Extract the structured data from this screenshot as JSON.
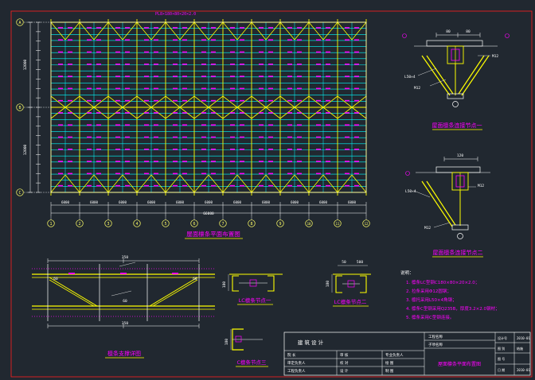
{
  "drawing": {
    "colors": {
      "background": "#212830",
      "purlin": "#00ffff",
      "bracing": "#ffff00",
      "dimension": "#ffffff",
      "annotation": "#ff00ff",
      "frame": "#ff2020",
      "grid_circle": "#ffff66",
      "highlight_text": "#ffff00"
    },
    "plan": {
      "top_label": "PL8×180×80×20×2.0",
      "title": "屋面檩条平面布置图",
      "column_labels": [
        "1",
        "2",
        "3",
        "4",
        "5",
        "6",
        "7",
        "8",
        "9",
        "10",
        "11",
        "12"
      ],
      "row_labels": [
        "A",
        "B",
        "C"
      ],
      "bay_dims": [
        "6000",
        "6000",
        "6000",
        "6000",
        "6000",
        "6000",
        "6000",
        "6000",
        "6000",
        "6000",
        "6000"
      ],
      "total_dim": "66000",
      "left_dims": [
        "12000",
        "12000"
      ]
    },
    "detail1": {
      "title": "屋面檩条连接节点一",
      "dims": [
        "80",
        "80"
      ],
      "callouts": [
        "L50×4",
        "M12",
        "M12"
      ]
    },
    "detail2": {
      "title": "屋面檩条连接节点二",
      "dims": [
        "120"
      ],
      "callouts": [
        "L50×4",
        "M12",
        "M12"
      ]
    },
    "detail_bracing": {
      "title": "檩条支撑详图",
      "dims": [
        "350",
        "350",
        "60",
        "60",
        "60"
      ]
    },
    "section1": {
      "title": "LC檩条节点一",
      "dim": "180"
    },
    "section2": {
      "title": "LC檩条节点二",
      "dim": "180",
      "top_dims": [
        "50",
        "500"
      ]
    },
    "section3": {
      "title": "C檩条节点三",
      "dim": "180"
    },
    "notes": {
      "heading": "说明：",
      "items": [
        "1. 檩条LC型钢C180×80×20×2.0；",
        "2. 拉条采用Φ12圆钢；",
        "3. 檩托采用L50×4角钢；",
        "4. 檩条C型钢采用Q235B，厚度3.2×2.0钢材；",
        "5. 檩条采用C型钢连接。"
      ]
    },
    "title_block": {
      "company": "建 筑 设 计",
      "project_label": "工程名称",
      "sub_label": "子项名称",
      "drawing_title": "屋面檩条平面布置图",
      "left_rows": [
        "院 长",
        "审定负责人",
        "工程负责人"
      ],
      "mid_rows": [
        "审 核",
        "校 对",
        "设 计"
      ],
      "right_rows": [
        "专业负责人",
        "绘 图",
        "制 图"
      ],
      "info_labels": [
        "设计号",
        "图 别",
        "图 号",
        "日 期"
      ],
      "info_values": [
        "2010-01",
        "结施",
        "",
        "2010-01"
      ]
    }
  }
}
